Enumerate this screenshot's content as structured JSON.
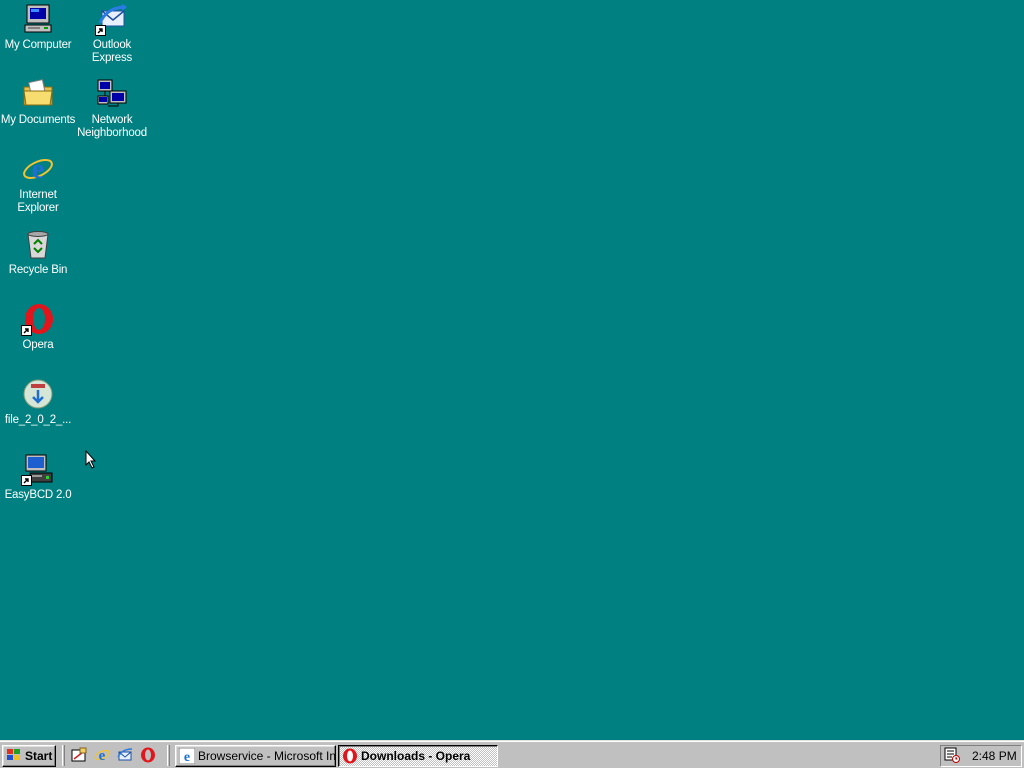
{
  "desktop": {
    "icons": [
      {
        "label": "My Computer",
        "icon": "my-computer-icon"
      },
      {
        "label": "Outlook Express",
        "icon": "outlook-express-icon"
      },
      {
        "label": "My Documents",
        "icon": "my-documents-icon"
      },
      {
        "label": "Network Neighborhood",
        "icon": "network-neighborhood-icon"
      },
      {
        "label": "Internet Explorer",
        "icon": "internet-explorer-icon"
      },
      {
        "label": "Recycle Bin",
        "icon": "recycle-bin-icon"
      },
      {
        "label": "Opera",
        "icon": "opera-icon"
      },
      {
        "label": "file_2_0_2_...",
        "icon": "installer-file-icon"
      },
      {
        "label": "EasyBCD 2.0",
        "icon": "easybcd-icon"
      }
    ]
  },
  "taskbar": {
    "start_label": "Start",
    "quick_launch": [
      "show-desktop-icon",
      "internet-explorer-icon",
      "outlook-express-icon",
      "opera-icon"
    ],
    "tasks": [
      {
        "label": "Browservice - Microsoft Int...",
        "icon": "internet-explorer-icon",
        "active": false
      },
      {
        "label": "Downloads - Opera",
        "icon": "opera-icon",
        "active": true
      }
    ],
    "tray": {
      "icons": [
        "scheduler-icon"
      ],
      "clock": "2:48 PM"
    }
  },
  "colors": {
    "desktop_bg": "#008080",
    "taskbar_bg": "#c0c0c0",
    "opera_red": "#e0161c",
    "ie_blue": "#1e6fd0"
  }
}
